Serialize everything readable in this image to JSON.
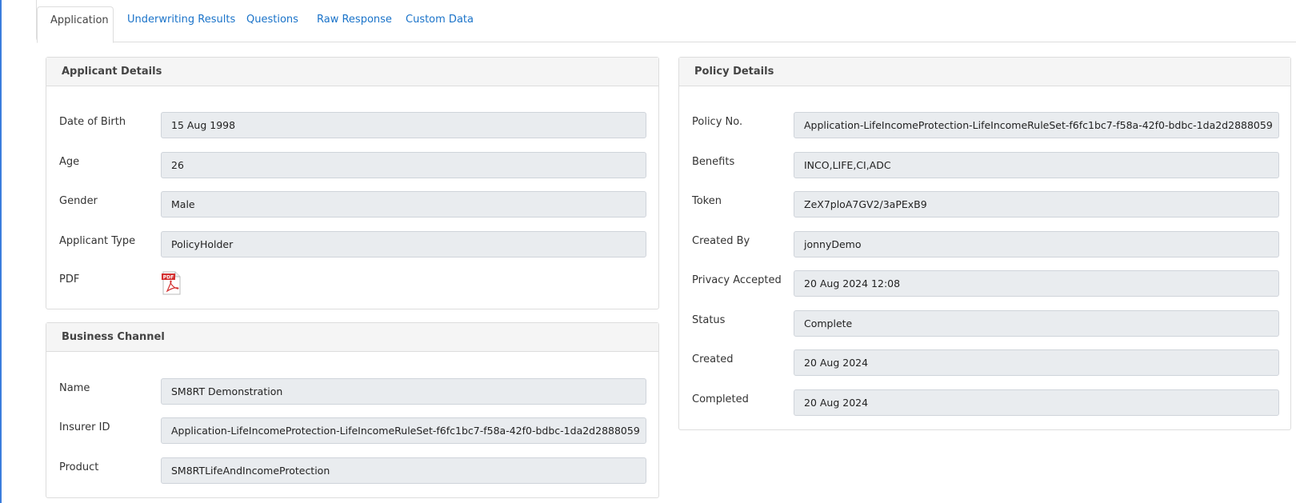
{
  "tabs": [
    {
      "label": "Application",
      "active": true
    },
    {
      "label": "Underwriting Results",
      "active": false
    },
    {
      "label": "Questions",
      "active": false
    },
    {
      "label": "Raw Response",
      "active": false
    },
    {
      "label": "Custom Data",
      "active": false
    }
  ],
  "applicant": {
    "title": "Applicant Details",
    "dob_label": "Date of Birth",
    "dob": "15 Aug 1998",
    "age_label": "Age",
    "age": "26",
    "gender_label": "Gender",
    "gender": "Male",
    "type_label": "Applicant Type",
    "type": "PolicyHolder",
    "pdf_label": "PDF",
    "pdf_icon": "pdf-file-icon",
    "pdf_icon_text": "PDF"
  },
  "business": {
    "title": "Business Channel",
    "name_label": "Name",
    "name": "SM8RT Demonstration",
    "insurer_label": "Insurer ID",
    "insurer": "Application-LifeIncomeProtection-LifeIncomeRuleSet-f6fc1bc7-f58a-42f0-bdbc-1da2d2888059",
    "product_label": "Product",
    "product": "SM8RTLifeAndIncomeProtection"
  },
  "policy": {
    "title": "Policy Details",
    "policy_no_label": "Policy No.",
    "policy_no": "Application-LifeIncomeProtection-LifeIncomeRuleSet-f6fc1bc7-f58a-42f0-bdbc-1da2d2888059",
    "benefits_label": "Benefits",
    "benefits": "INCO,LIFE,CI,ADC",
    "token_label": "Token",
    "token": "ZeX7ploA7GV2/3aPExB9",
    "created_by_label": "Created By",
    "created_by": "jonnyDemo",
    "privacy_label": "Privacy Accepted",
    "privacy": "20 Aug 2024 12:08",
    "status_label": "Status",
    "status": "Complete",
    "created_label": "Created",
    "created": "20 Aug 2024",
    "completed_label": "Completed",
    "completed": "20 Aug 2024"
  },
  "colors": {
    "link": "#1a73c9",
    "accent": "#3b7ddd",
    "field_bg": "#e9ecef",
    "pdf_red": "#d32f2f"
  }
}
